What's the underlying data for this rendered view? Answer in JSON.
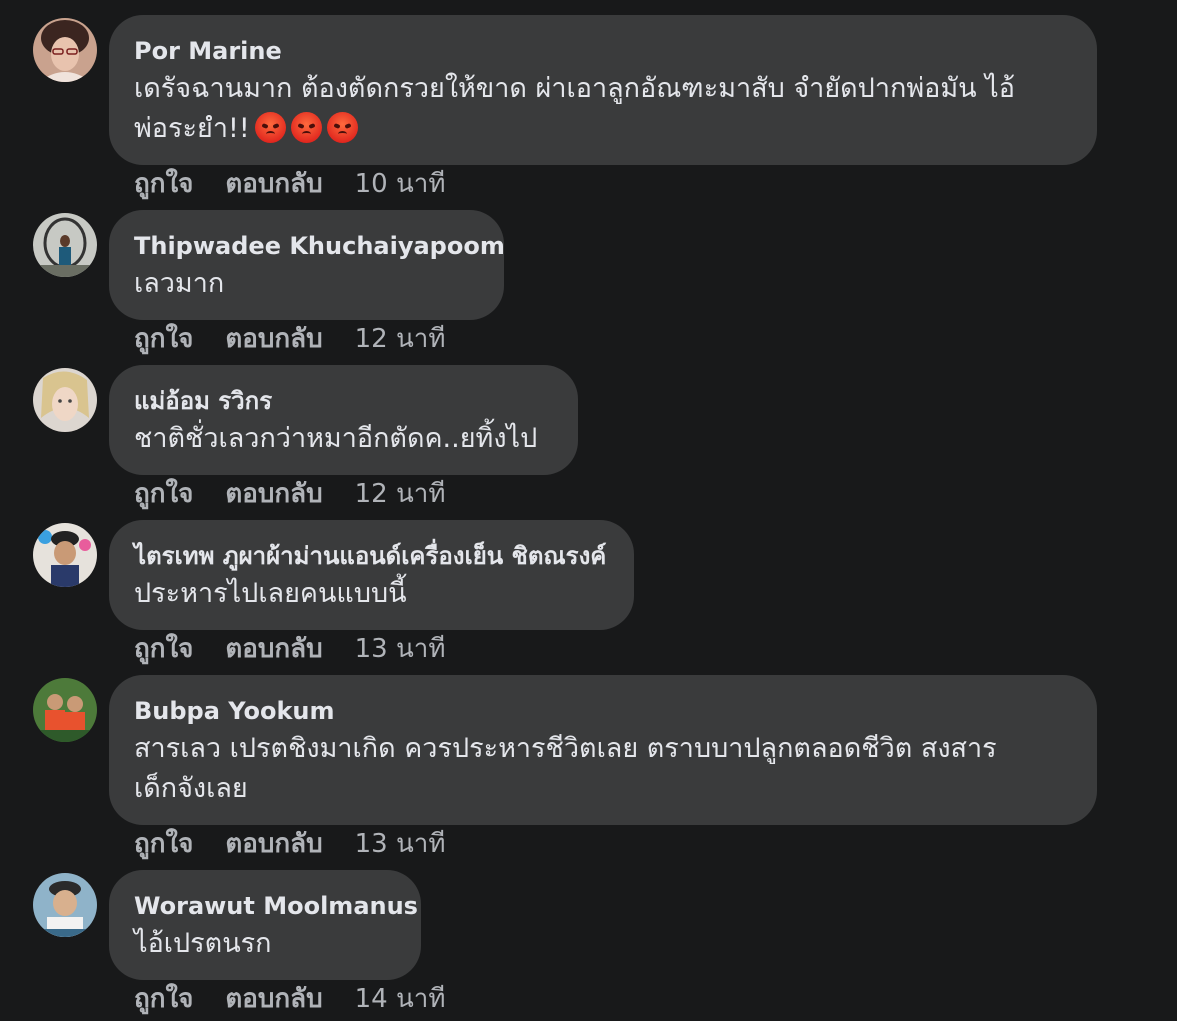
{
  "actions": {
    "like": "ถูกใจ",
    "reply": "ตอบกลับ"
  },
  "comments": [
    {
      "author": "Por Marine",
      "text_line1": "เดรัจฉานมาก ต้องตัดกรวยให้ขาด ผ่าเอาลูกอัณฑะมาสับ จำยัดปากพ่อมัน ไอ้",
      "text_line2": "พ่อระยำ!!",
      "emojis": [
        "pouting-face",
        "pouting-face",
        "pouting-face"
      ],
      "time": "10 นาที"
    },
    {
      "author": "Thipwadee Khuchaiyapoom",
      "text": "เลวมาก",
      "time": "12 นาที"
    },
    {
      "author": "แม่อ้อม รวิกร",
      "text": "ชาติชั่วเลวกว่าหมาอีกตัดค..ยทิ้งไป",
      "time": "12 นาที"
    },
    {
      "author": "ไตรเทพ ภูผาผ้าม่านแอนด์เครื่องเย็น ชิตณรงค์",
      "text": "ประหารไปเลยคนแบบนี้",
      "time": "13 นาที"
    },
    {
      "author": "Bubpa Yookum",
      "text_line1": "สารเลว เปรตชิงมาเกิด ควรประหารชีวิตเลย ตราบบาปลูกตลอดชีวิต สงสาร",
      "text_line2": "เด็กจังเลย",
      "time": "13 นาที"
    },
    {
      "author": "Worawut Moolmanus",
      "text": "ไอ้เปรตนรก",
      "time": "14 นาที"
    }
  ],
  "colors": {
    "background": "#18191a",
    "bubble": "#3a3b3c",
    "primary_text": "#e4e6eb",
    "secondary_text": "#b0b3b8"
  }
}
